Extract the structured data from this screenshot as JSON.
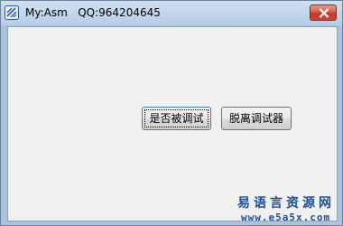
{
  "window": {
    "title": "My:Asm   QQ:964204645",
    "close_glyph": "×"
  },
  "icons": {
    "app": "app-logo-icon",
    "close": "close-icon"
  },
  "buttons": {
    "check_debug": "是否被调试",
    "detach_debugger": "脱离调试器"
  },
  "watermark": {
    "site_name": "易语言资源网",
    "url": "www.e5a5x.com"
  },
  "colors": {
    "titlebar": "#b6cde6",
    "close_button": "#c9492f",
    "client_background": "#f0f0f0",
    "watermark": "#1f4f93"
  }
}
